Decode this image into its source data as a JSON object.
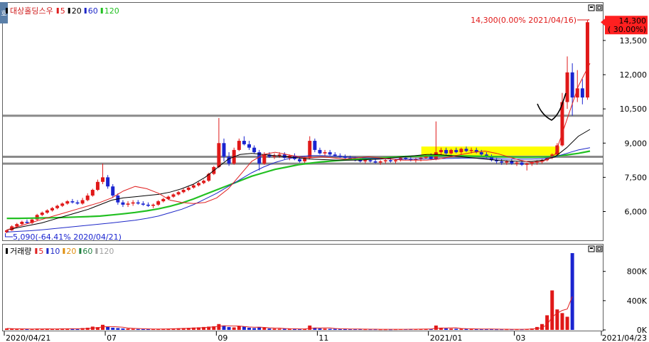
{
  "chart_data": {
    "type": "candlestick",
    "price_panel": {
      "legend": {
        "name": "대상홀딩스우",
        "ma_items": [
          {
            "label": "5",
            "color": "#e02020"
          },
          {
            "label": "20",
            "color": "#000000"
          },
          {
            "label": "60",
            "color": "#1e28c8"
          },
          {
            "label": "120",
            "color": "#22c022"
          }
        ]
      },
      "y_ticks": [
        "13,500",
        "12,000",
        "10,500",
        "9,000",
        "7,500",
        "6,000"
      ],
      "y_tick_values": [
        13500,
        12000,
        10500,
        9000,
        7500,
        6000
      ],
      "ylim": [
        4800,
        14900
      ],
      "current_price": "14,300",
      "current_change": "( 30.00%)",
      "high_annotation": "14,300(0.00% 2021/04/16)",
      "low_annotation": "5,090(-64.41% 2020/04/21)",
      "support_lines": [
        10200,
        8400,
        8100
      ],
      "highlight_box": {
        "x_start": 0.712,
        "x_end": 0.948,
        "y_low": 8450,
        "y_high": 8850
      },
      "candles": [
        [
          5090,
          5200,
          5050,
          5180
        ],
        [
          5180,
          5400,
          5150,
          5350
        ],
        [
          5350,
          5500,
          5300,
          5450
        ],
        [
          5450,
          5600,
          5400,
          5550
        ],
        [
          5550,
          5650,
          5450,
          5500
        ],
        [
          5500,
          5700,
          5450,
          5650
        ],
        [
          5650,
          5900,
          5600,
          5850
        ],
        [
          5850,
          6000,
          5800,
          5950
        ],
        [
          5950,
          6100,
          5900,
          6050
        ],
        [
          6050,
          6200,
          6000,
          6150
        ],
        [
          6150,
          6300,
          6100,
          6250
        ],
        [
          6250,
          6400,
          6200,
          6350
        ],
        [
          6350,
          6500,
          6300,
          6450
        ],
        [
          6450,
          6550,
          6350,
          6400
        ],
        [
          6400,
          6500,
          6300,
          6350
        ],
        [
          6350,
          6600,
          6300,
          6500
        ],
        [
          6500,
          6800,
          6450,
          6700
        ],
        [
          6700,
          7000,
          6650,
          6950
        ],
        [
          6950,
          7400,
          6900,
          7300
        ],
        [
          7300,
          8100,
          7200,
          7500
        ],
        [
          7500,
          7600,
          7000,
          7100
        ],
        [
          7100,
          7200,
          6600,
          6700
        ],
        [
          6700,
          6800,
          6300,
          6400
        ],
        [
          6400,
          6500,
          6200,
          6300
        ],
        [
          6300,
          6450,
          6200,
          6350
        ],
        [
          6350,
          6500,
          6250,
          6400
        ],
        [
          6400,
          6500,
          6300,
          6350
        ],
        [
          6350,
          6450,
          6250,
          6300
        ],
        [
          6300,
          6400,
          6200,
          6250
        ],
        [
          6250,
          6350,
          6150,
          6300
        ],
        [
          6300,
          6500,
          6250,
          6450
        ],
        [
          6450,
          6600,
          6400,
          6550
        ],
        [
          6550,
          6700,
          6500,
          6650
        ],
        [
          6650,
          6800,
          6600,
          6750
        ],
        [
          6750,
          6900,
          6700,
          6850
        ],
        [
          6850,
          7000,
          6800,
          6950
        ],
        [
          6950,
          7100,
          6900,
          7050
        ],
        [
          7050,
          7200,
          7000,
          7150
        ],
        [
          7150,
          7300,
          7100,
          7250
        ],
        [
          7250,
          7400,
          7200,
          7350
        ],
        [
          7350,
          7700,
          7300,
          7650
        ],
        [
          7650,
          8000,
          7600,
          7950
        ],
        [
          7950,
          10100,
          7900,
          9000
        ],
        [
          9000,
          9200,
          8200,
          8400
        ],
        [
          8400,
          8600,
          8000,
          8100
        ],
        [
          8100,
          8800,
          8050,
          8700
        ],
        [
          8700,
          9200,
          8650,
          9100
        ],
        [
          9100,
          9300,
          8900,
          8950
        ],
        [
          8950,
          9100,
          8700,
          8800
        ],
        [
          8800,
          8900,
          8550,
          8600
        ],
        [
          8600,
          8700,
          7800,
          8100
        ],
        [
          8100,
          8600,
          8050,
          8500
        ],
        [
          8500,
          8600,
          8350,
          8400
        ],
        [
          8400,
          8550,
          8300,
          8450
        ],
        [
          8450,
          8600,
          8350,
          8500
        ],
        [
          8500,
          8600,
          8300,
          8350
        ],
        [
          8350,
          8500,
          8250,
          8450
        ],
        [
          8450,
          8550,
          8250,
          8300
        ],
        [
          8300,
          8400,
          8150,
          8200
        ],
        [
          8200,
          8400,
          8100,
          8350
        ],
        [
          8350,
          9300,
          8300,
          9100
        ],
        [
          9100,
          9200,
          8600,
          8700
        ],
        [
          8700,
          8800,
          8500,
          8550
        ],
        [
          8550,
          8700,
          8450,
          8600
        ],
        [
          8600,
          8700,
          8450,
          8500
        ],
        [
          8500,
          8600,
          8400,
          8450
        ],
        [
          8450,
          8550,
          8350,
          8400
        ],
        [
          8400,
          8500,
          8300,
          8350
        ],
        [
          8350,
          8450,
          8250,
          8300
        ],
        [
          8300,
          8400,
          8200,
          8250
        ],
        [
          8250,
          8350,
          8150,
          8200
        ],
        [
          8200,
          8300,
          8100,
          8250
        ],
        [
          8250,
          8350,
          8150,
          8200
        ],
        [
          8200,
          8300,
          8100,
          8150
        ],
        [
          8150,
          8250,
          8050,
          8200
        ],
        [
          8200,
          8300,
          8100,
          8250
        ],
        [
          8250,
          8350,
          8150,
          8200
        ],
        [
          8200,
          8300,
          8100,
          8250
        ],
        [
          8250,
          8400,
          8200,
          8350
        ],
        [
          8350,
          8450,
          8250,
          8300
        ],
        [
          8300,
          8400,
          8200,
          8250
        ],
        [
          8250,
          8350,
          8150,
          8300
        ],
        [
          8300,
          8400,
          8200,
          8350
        ],
        [
          8350,
          8500,
          8300,
          8450
        ],
        [
          8450,
          8550,
          8250,
          8300
        ],
        [
          8300,
          9950,
          8250,
          8600
        ],
        [
          8600,
          8800,
          8450,
          8700
        ],
        [
          8700,
          8800,
          8500,
          8550
        ],
        [
          8550,
          8750,
          8500,
          8700
        ],
        [
          8700,
          8800,
          8550,
          8600
        ],
        [
          8600,
          8800,
          8500,
          8750
        ],
        [
          8750,
          8850,
          8600,
          8650
        ],
        [
          8650,
          8800,
          8550,
          8700
        ],
        [
          8700,
          8800,
          8550,
          8600
        ],
        [
          8600,
          8700,
          8450,
          8500
        ],
        [
          8500,
          8600,
          8350,
          8400
        ],
        [
          8400,
          8500,
          8200,
          8250
        ],
        [
          8250,
          8350,
          8100,
          8200
        ],
        [
          8200,
          8300,
          8050,
          8150
        ],
        [
          8150,
          8250,
          8050,
          8200
        ],
        [
          8200,
          8300,
          8050,
          8100
        ],
        [
          8100,
          8200,
          8000,
          8150
        ],
        [
          8150,
          8250,
          8000,
          8050
        ],
        [
          8050,
          8150,
          7800,
          8100
        ],
        [
          8100,
          8200,
          8000,
          8150
        ],
        [
          8150,
          8250,
          8050,
          8200
        ],
        [
          8200,
          8300,
          8100,
          8250
        ],
        [
          8250,
          8400,
          8200,
          8350
        ],
        [
          8350,
          8550,
          8300,
          8500
        ],
        [
          8500,
          9000,
          8450,
          8900
        ],
        [
          8900,
          11200,
          8850,
          10800
        ],
        [
          10800,
          12800,
          10500,
          12100
        ],
        [
          12100,
          12500,
          10200,
          11000
        ],
        [
          11000,
          12200,
          10800,
          11400
        ],
        [
          11400,
          11800,
          10700,
          11000
        ],
        [
          11000,
          14400,
          10900,
          14300
        ]
      ],
      "ma5": [
        5200,
        5350,
        5500,
        5650,
        5800,
        5950,
        6100,
        6250,
        6400,
        6600,
        6900,
        7100,
        7000,
        6800,
        6500,
        6400,
        6350,
        6400,
        6600,
        7000,
        7600,
        8200,
        8500,
        8600,
        8500,
        8400,
        8350,
        8400,
        8350,
        8300,
        8350,
        8400,
        8350,
        8300,
        8250,
        8250,
        8250,
        8300,
        8400,
        8500,
        8600,
        8650,
        8550,
        8400,
        8250,
        8150,
        8200,
        8500,
        10000,
        11500,
        12500
      ],
      "ma20": [
        5200,
        5300,
        5400,
        5500,
        5650,
        5800,
        5950,
        6100,
        6300,
        6500,
        6600,
        6650,
        6700,
        6750,
        6850,
        7000,
        7200,
        7500,
        7900,
        8300,
        8500,
        8550,
        8500,
        8450,
        8400,
        8350,
        8300,
        8280,
        8260,
        8250,
        8250,
        8280,
        8300,
        8350,
        8400,
        8450,
        8500,
        8500,
        8450,
        8400,
        8350,
        8300,
        8250,
        8220,
        8200,
        8200,
        8250,
        8400,
        8800,
        9300,
        9600
      ],
      "ma60": [
        5100,
        5130,
        5160,
        5200,
        5250,
        5300,
        5350,
        5400,
        5450,
        5500,
        5560,
        5620,
        5700,
        5800,
        5950,
        6100,
        6300,
        6550,
        6800,
        7100,
        7400,
        7700,
        7950,
        8150,
        8300,
        8400,
        8450,
        8450,
        8430,
        8400,
        8370,
        8340,
        8320,
        8300,
        8300,
        8300,
        8310,
        8320,
        8330,
        8340,
        8340,
        8330,
        8310,
        8300,
        8300,
        8300,
        8320,
        8400,
        8550,
        8700,
        8800
      ],
      "ma120": [
        5700,
        5700,
        5710,
        5720,
        5730,
        5740,
        5760,
        5780,
        5800,
        5850,
        5900,
        5960,
        6030,
        6120,
        6230,
        6370,
        6550,
        6750,
        6950,
        7150,
        7350,
        7550,
        7700,
        7850,
        7950,
        8050,
        8120,
        8180,
        8220,
        8260,
        8290,
        8320,
        8350,
        8380,
        8410,
        8430,
        8440,
        8450,
        8450,
        8440,
        8430,
        8420,
        8400,
        8390,
        8380,
        8380,
        8390,
        8420,
        8480,
        8550,
        8650
      ]
    },
    "volume_panel": {
      "legend": {
        "name": "거래량",
        "ma_items": [
          {
            "label": "5",
            "color": "#e02020"
          },
          {
            "label": "10",
            "color": "#1e28c8"
          },
          {
            "label": "20",
            "color": "#e09010"
          },
          {
            "label": "60",
            "color": "#208040"
          },
          {
            "label": "120",
            "color": "#a0a0a0"
          }
        ]
      },
      "y_ticks": [
        "800K",
        "400K",
        "0K"
      ],
      "y_tick_values": [
        800000,
        400000,
        0
      ],
      "ylim": [
        0,
        1050000
      ],
      "volumes": [
        20000,
        15000,
        12000,
        10000,
        12000,
        15000,
        18000,
        14000,
        12000,
        11000,
        15000,
        20000,
        18000,
        14000,
        12000,
        25000,
        30000,
        45000,
        38000,
        70000,
        40000,
        30000,
        25000,
        20000,
        18000,
        15000,
        12000,
        11000,
        10000,
        12000,
        14000,
        16000,
        18000,
        20000,
        22000,
        25000,
        28000,
        32000,
        35000,
        40000,
        45000,
        50000,
        80000,
        60000,
        40000,
        35000,
        50000,
        45000,
        30000,
        25000,
        40000,
        30000,
        20000,
        18000,
        16000,
        15000,
        14000,
        13000,
        12000,
        15000,
        60000,
        30000,
        20000,
        18000,
        15000,
        14000,
        13000,
        12000,
        11000,
        10000,
        10000,
        9000,
        9000,
        9000,
        8000,
        8000,
        8000,
        9000,
        10000,
        10000,
        10000,
        10000,
        12000,
        14000,
        12000,
        60000,
        30000,
        20000,
        18000,
        16000,
        15000,
        14000,
        13000,
        12000,
        11000,
        10000,
        10000,
        9000,
        9000,
        9000,
        9000,
        9000,
        9000,
        12000,
        20000,
        40000,
        80000,
        200000,
        540000,
        280000,
        230000,
        180000,
        1050000
      ]
    },
    "x_ticks": [
      {
        "label": "2020/04/21",
        "index": 0
      },
      {
        "label": "07",
        "index": 20
      },
      {
        "label": "09",
        "index": 42
      },
      {
        "label": "11",
        "index": 62
      },
      {
        "label": "2021/01",
        "index": 84
      },
      {
        "label": "03",
        "index": 101
      },
      {
        "label": "2021/04/23",
        "index": 112
      }
    ]
  }
}
